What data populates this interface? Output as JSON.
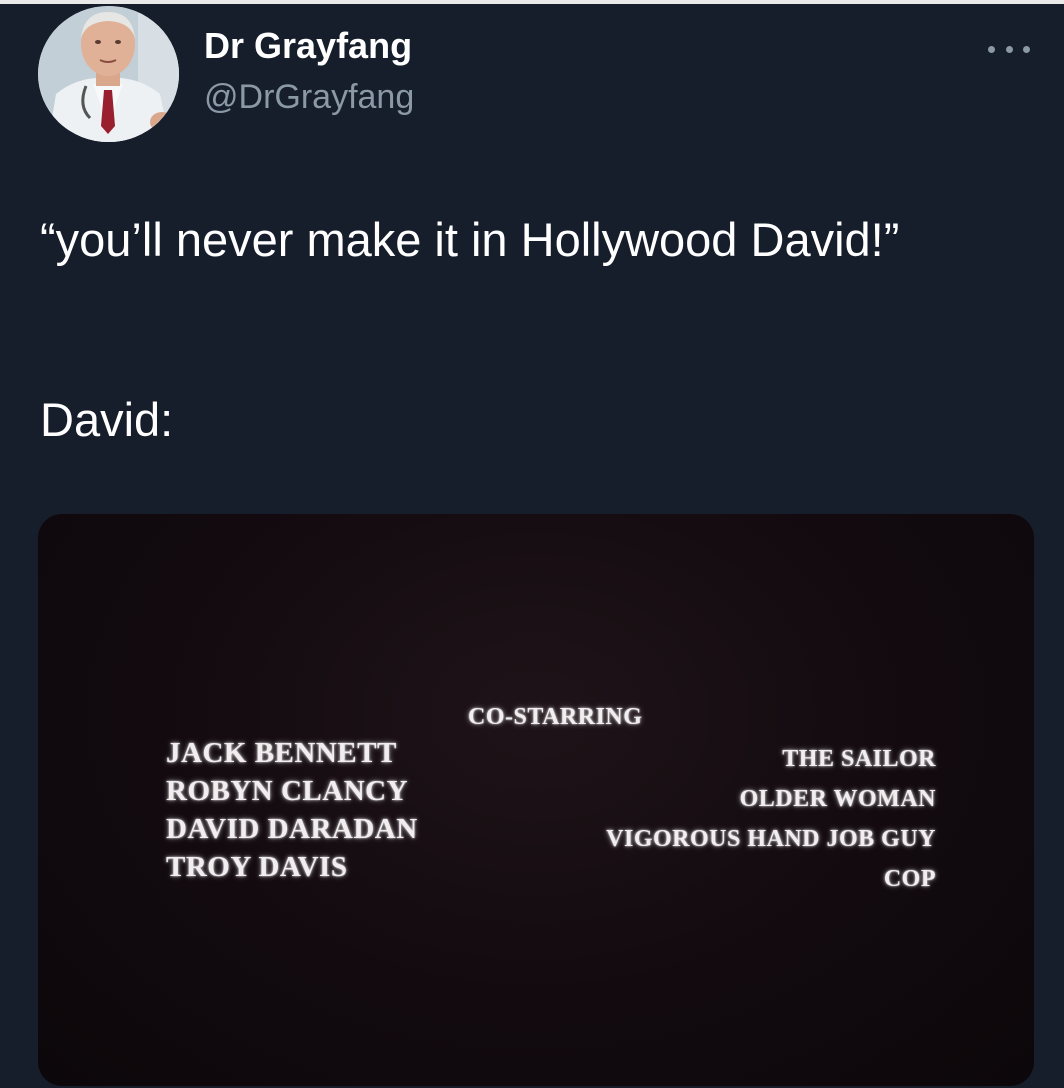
{
  "tweet": {
    "author": {
      "display_name": "Dr Grayfang",
      "handle": "@DrGrayfang",
      "avatar_icon": "profile-photo"
    },
    "more_icon": "more-horizontal-icon",
    "text_line_1": "“you’ll never make it in Hollywood David!”",
    "text_line_2": "David:"
  },
  "media": {
    "heading": "CO-STARRING",
    "actors": [
      "JACK BENNETT",
      "ROBYN CLANCY",
      "DAVID DARADAN",
      "TROY DAVIS"
    ],
    "roles": [
      "THE SAILOR",
      "OLDER WOMAN",
      "VIGOROUS HAND JOB GUY",
      "COP"
    ]
  },
  "colors": {
    "background": "#161d2b",
    "text": "#ffffff",
    "secondary_text": "#8b98a5"
  }
}
